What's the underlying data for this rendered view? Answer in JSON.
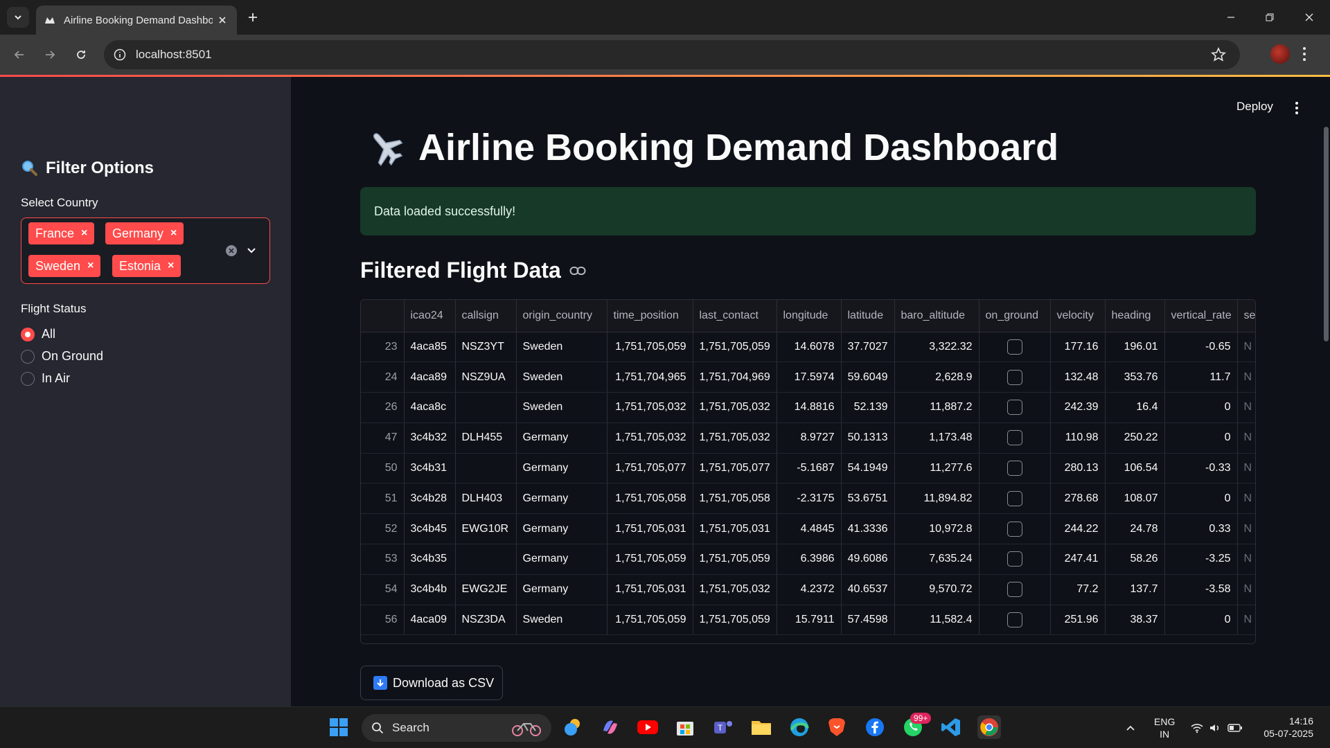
{
  "browser": {
    "tab_title": "Airline Booking Demand Dashboard",
    "url": "localhost:8501"
  },
  "colors": {
    "accent": "#ff4b4b",
    "success_bg": "#173928",
    "sidebar_bg": "#262730",
    "main_bg": "#0e1117"
  },
  "sidebar": {
    "header": "Filter Options",
    "country_label": "Select Country",
    "countries": [
      "France",
      "Germany",
      "Sweden",
      "Estonia"
    ],
    "status_label": "Flight Status",
    "status_options": [
      "All",
      "On Ground",
      "In Air"
    ],
    "status_selected": "All"
  },
  "app": {
    "deploy_label": "Deploy",
    "title": "Airline Booking Demand Dashboard",
    "success_message": "Data loaded successfully!",
    "subheader": "Filtered Flight Data",
    "download_label": "Download as CSV"
  },
  "table": {
    "columns": [
      "",
      "icao24",
      "callsign",
      "origin_country",
      "time_position",
      "last_contact",
      "longitude",
      "latitude",
      "baro_altitude",
      "on_ground",
      "velocity",
      "heading",
      "vertical_rate",
      "se"
    ],
    "rows": [
      [
        "23",
        "4aca85",
        "NSZ3YT",
        "Sweden",
        "1,751,705,059",
        "1,751,705,059",
        "14.6078",
        "37.7027",
        "3,322.32",
        "",
        "177.16",
        "196.01",
        "-0.65",
        "N"
      ],
      [
        "24",
        "4aca89",
        "NSZ9UA",
        "Sweden",
        "1,751,704,965",
        "1,751,704,969",
        "17.5974",
        "59.6049",
        "2,628.9",
        "",
        "132.48",
        "353.76",
        "11.7",
        "N"
      ],
      [
        "26",
        "4aca8c",
        "",
        "Sweden",
        "1,751,705,032",
        "1,751,705,032",
        "14.8816",
        "52.139",
        "11,887.2",
        "",
        "242.39",
        "16.4",
        "0",
        "N"
      ],
      [
        "47",
        "3c4b32",
        "DLH455",
        "Germany",
        "1,751,705,032",
        "1,751,705,032",
        "8.9727",
        "50.1313",
        "1,173.48",
        "",
        "110.98",
        "250.22",
        "0",
        "N"
      ],
      [
        "50",
        "3c4b31",
        "",
        "Germany",
        "1,751,705,077",
        "1,751,705,077",
        "-5.1687",
        "54.1949",
        "11,277.6",
        "",
        "280.13",
        "106.54",
        "-0.33",
        "N"
      ],
      [
        "51",
        "3c4b28",
        "DLH403",
        "Germany",
        "1,751,705,058",
        "1,751,705,058",
        "-2.3175",
        "53.6751",
        "11,894.82",
        "",
        "278.68",
        "108.07",
        "0",
        "N"
      ],
      [
        "52",
        "3c4b45",
        "EWG10R",
        "Germany",
        "1,751,705,031",
        "1,751,705,031",
        "4.4845",
        "41.3336",
        "10,972.8",
        "",
        "244.22",
        "24.78",
        "0.33",
        "N"
      ],
      [
        "53",
        "3c4b35",
        "",
        "Germany",
        "1,751,705,059",
        "1,751,705,059",
        "6.3986",
        "49.6086",
        "7,635.24",
        "",
        "247.41",
        "58.26",
        "-3.25",
        "N"
      ],
      [
        "54",
        "3c4b4b",
        "EWG2JE",
        "Germany",
        "1,751,705,031",
        "1,751,705,032",
        "4.2372",
        "40.6537",
        "9,570.72",
        "",
        "77.2",
        "137.7",
        "-3.58",
        "N"
      ],
      [
        "56",
        "4aca09",
        "NSZ3DA",
        "Sweden",
        "1,751,705,059",
        "1,751,705,059",
        "15.7911",
        "57.4598",
        "11,582.4",
        "",
        "251.96",
        "38.37",
        "0",
        "N"
      ]
    ]
  },
  "taskbar": {
    "search_label": "Search",
    "badge": "99+",
    "lang": "ENG",
    "region": "IN",
    "time": "14:16",
    "date": "05-07-2025"
  }
}
